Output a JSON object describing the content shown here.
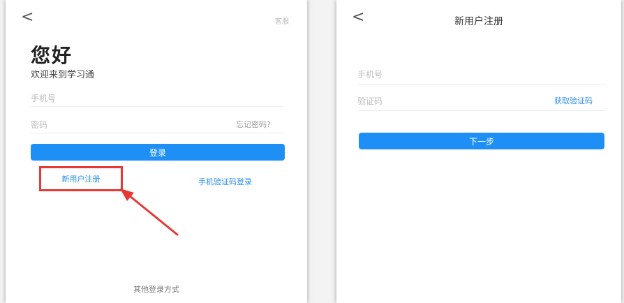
{
  "left_screen": {
    "back_glyph": "<",
    "top_right": "客服",
    "greeting": "您好",
    "welcome": "欢迎来到学习通",
    "phone_placeholder": "手机号",
    "password_placeholder": "密码",
    "forgot_password": "忘记密码?",
    "login_button": "登录",
    "register_link": "新用户注册",
    "sms_login_link": "手机验证码登录",
    "other_methods": "其他登录方式"
  },
  "right_screen": {
    "back_glyph": "<",
    "title": "新用户注册",
    "phone_placeholder": "手机号",
    "code_placeholder": "验证码",
    "get_code": "获取验证码",
    "next_button": "下一步"
  },
  "colors": {
    "accent": "#1e90f5",
    "link": "#2a8ff0",
    "highlight": "#e53935"
  }
}
